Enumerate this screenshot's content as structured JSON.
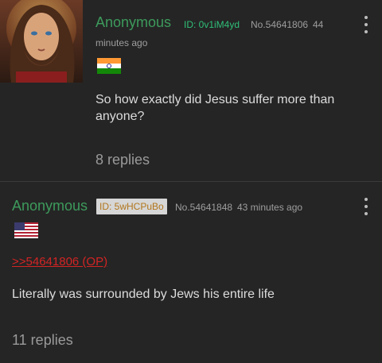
{
  "posts": [
    {
      "name": "Anonymous",
      "poster_id": "ID: 0v1iM4yd",
      "post_no": "No.54641806",
      "time_ago": "44",
      "time_ago_cont": "minutes ago",
      "flag": "India",
      "comment": "So how exactly did Jesus suffer more than anyone?",
      "replies": "8 replies"
    },
    {
      "name": "Anonymous",
      "poster_id": "ID: 5wHCPuBo",
      "post_no": "No.54641848",
      "time_ago": "43 minutes ago",
      "flag": "United States",
      "quote_link": ">>54641806 (OP)",
      "comment": "Literally was surrounded by Jews his entire life",
      "replies": "11 replies"
    }
  ],
  "colors": {
    "background": "#252525",
    "name": "#3d9a5c",
    "poster_id_plain": "#2fbf78",
    "poster_id_boxed_text": "#b1761c",
    "quote_link": "#d32424"
  }
}
